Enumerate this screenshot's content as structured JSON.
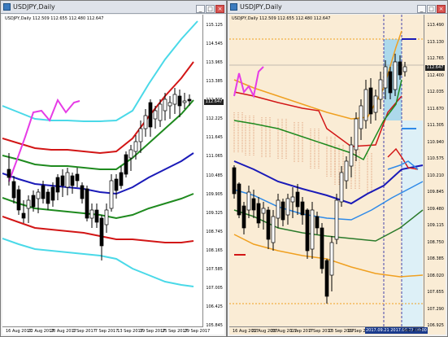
{
  "left": {
    "title": "USDJPY,Daily",
    "symbol_line": "USDJPY,Daily  112.509 112.655 112.480 112.647",
    "current_price": "112.647",
    "prices": [
      "115.125",
      "114.545",
      "113.965",
      "113.385",
      "112.805",
      "112.225",
      "111.645",
      "111.065",
      "110.485",
      "109.905",
      "109.325",
      "108.745",
      "108.165",
      "107.585",
      "107.005",
      "106.425",
      "105.845"
    ],
    "dates": [
      "16 Aug 2017",
      "22 Aug 2017",
      "28 Aug 2017",
      "1 Sep 2017",
      "7 Sep 2017",
      "13 Sep 2017",
      "19 Sep 2017",
      "25 Sep 2017",
      "29 Sep 2017"
    ]
  },
  "right": {
    "title": "USDJPY,Daily",
    "symbol_line": "USDJPY,Daily  112.509 112.655 112.480 112.647",
    "current_price": "112.647",
    "prices": [
      "113.490",
      "113.130",
      "112.765",
      "112.400",
      "112.035",
      "111.670",
      "111.305",
      "110.940",
      "110.575",
      "110.210",
      "109.845",
      "109.480",
      "109.115",
      "108.750",
      "108.385",
      "108.020",
      "107.655",
      "107.290",
      "106.925"
    ],
    "dates": [
      "16 Aug 2017",
      "22 Aug 2017",
      "28 Aug 2017",
      "1 Sep 2017",
      "7 Sep 2017",
      "13 Sep 2017",
      "19 Sep 2017"
    ],
    "highlight_date": "2017.09.21 2017.09.27 00:00",
    "last_date": "Sep 2017"
  },
  "colors": {
    "left_bg": "#ffffff",
    "right_bg": "#faecd5",
    "bull": "#ffffff",
    "bear": "#000000",
    "band_outer": "#4ad9e8",
    "band_2": "#d21616",
    "band_1": "#1f8a1f",
    "center": "#1a1ab8",
    "magenta": "#e63ce6",
    "orange": "#f0a020",
    "blue_light": "#2f8ae8",
    "green_dark": "#2a7a2a"
  }
}
